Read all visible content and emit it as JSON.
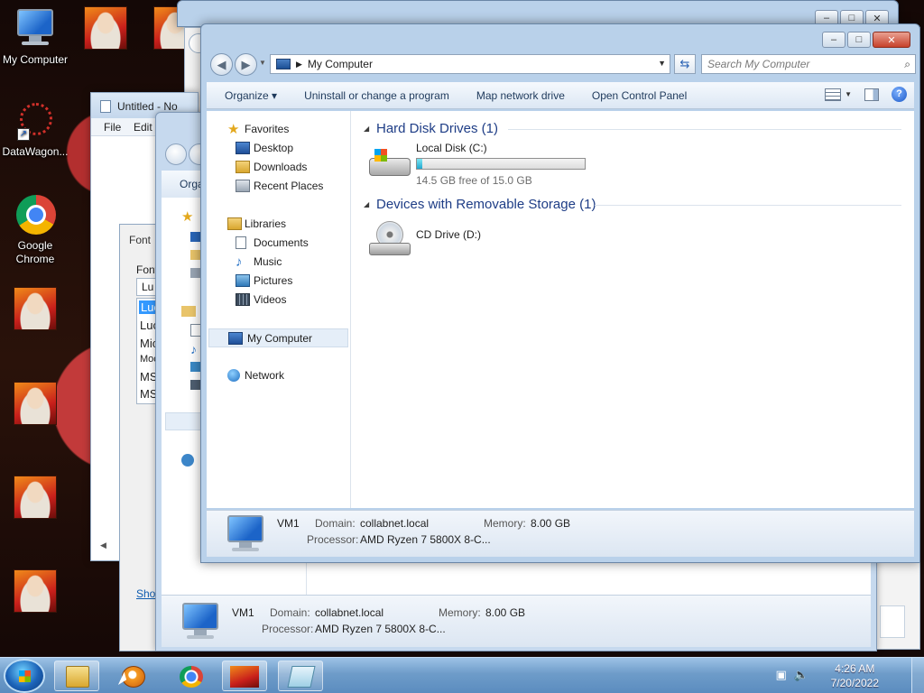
{
  "desktop": {
    "icons": [
      {
        "label": "My Computer"
      },
      {
        "label": "DataWagon..."
      },
      {
        "label": "Google Chrome"
      }
    ]
  },
  "notepad": {
    "title": "Untitled - No",
    "menu": [
      "File",
      "Edit"
    ]
  },
  "font_dialog": {
    "title": "Font",
    "label": "Font",
    "input_value": "Lu",
    "options": [
      "Luc",
      "Luc",
      "Mic",
      "Moc",
      "MS",
      "MS"
    ],
    "footer_link": "Shot"
  },
  "back_explorer": {
    "organize": "Orga",
    "details": {
      "name": "VM1",
      "domain_label": "Domain:",
      "domain_value": "collabnet.local",
      "memory_label": "Memory:",
      "memory_value": "8.00 GB",
      "processor_label": "Processor:",
      "processor_value": "AMD Ryzen 7 5800X 8-C..."
    }
  },
  "explorer": {
    "address": "My Computer",
    "search_placeholder": "Search My Computer",
    "commands": [
      "Organize ▾",
      "Uninstall or change a program",
      "Map network drive",
      "Open Control Panel"
    ],
    "nav": {
      "favorites": "Favorites",
      "desktop": "Desktop",
      "downloads": "Downloads",
      "recent": "Recent Places",
      "libraries": "Libraries",
      "documents": "Documents",
      "music": "Music",
      "pictures": "Pictures",
      "videos": "Videos",
      "computer": "My Computer",
      "network": "Network"
    },
    "groups": {
      "hdd": "Hard Disk Drives (1)",
      "removable": "Devices with Removable Storage (1)"
    },
    "drives": {
      "c_label": "Local Disk (C:)",
      "c_free": "14.5 GB free of 15.0 GB",
      "c_used_fraction": 0.033,
      "d_label": "CD Drive (D:)"
    },
    "details": {
      "name": "VM1",
      "domain_label": "Domain:",
      "domain_value": "collabnet.local",
      "memory_label": "Memory:",
      "memory_value": "8.00 GB",
      "processor_label": "Processor:",
      "processor_value": "AMD Ryzen 7 5800X 8-C..."
    }
  },
  "taskbar": {
    "time": "4:26 AM",
    "date": "7/20/2022"
  }
}
